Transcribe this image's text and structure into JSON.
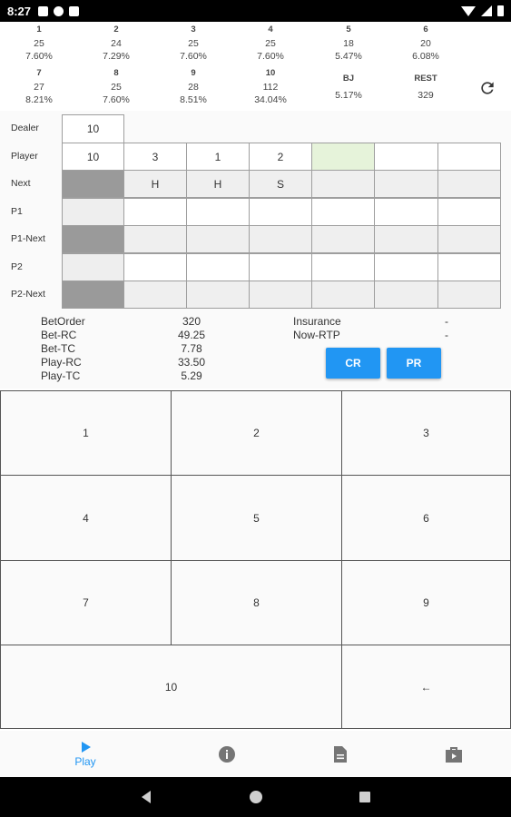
{
  "status_bar": {
    "time": "8:27"
  },
  "stats_row1": [
    {
      "label": "1",
      "count": "25",
      "pct": "7.60%"
    },
    {
      "label": "2",
      "count": "24",
      "pct": "7.29%"
    },
    {
      "label": "3",
      "count": "25",
      "pct": "7.60%"
    },
    {
      "label": "4",
      "count": "25",
      "pct": "7.60%"
    },
    {
      "label": "5",
      "count": "18",
      "pct": "5.47%"
    },
    {
      "label": "6",
      "count": "20",
      "pct": "6.08%"
    }
  ],
  "stats_row2": [
    {
      "label": "7",
      "count": "27",
      "pct": "8.21%"
    },
    {
      "label": "8",
      "count": "25",
      "pct": "7.60%"
    },
    {
      "label": "9",
      "count": "28",
      "pct": "8.51%"
    },
    {
      "label": "10",
      "count": "112",
      "pct": "34.04%"
    },
    {
      "label": "BJ",
      "value": "5.17%"
    },
    {
      "label": "REST",
      "value": "329"
    }
  ],
  "grid": {
    "row_labels": [
      "Dealer",
      "Player",
      "Next",
      "P1",
      "P1-Next",
      "P2",
      "P2-Next"
    ],
    "dealer_value": "10",
    "player_values": [
      "10",
      "3",
      "1",
      "2",
      "",
      "",
      ""
    ],
    "next_values": [
      "",
      "H",
      "H",
      "S",
      "",
      "",
      ""
    ]
  },
  "info": {
    "labels": [
      "BetOrder",
      "Bet-RC",
      "Bet-TC",
      "Play-RC",
      "Play-TC"
    ],
    "values": [
      "320",
      "49.25",
      "7.78",
      "33.50",
      "5.29"
    ],
    "right_labels": [
      "Insurance",
      "Now-RTP"
    ],
    "right_values": [
      "-",
      "-"
    ]
  },
  "buttons": {
    "cr": "CR",
    "pr": "PR"
  },
  "keypad": [
    "1",
    "2",
    "3",
    "4",
    "5",
    "6",
    "7",
    "8",
    "9",
    "10",
    "←"
  ],
  "bottom_nav": {
    "play_label": "Play",
    "active_color": "#2196f3"
  }
}
